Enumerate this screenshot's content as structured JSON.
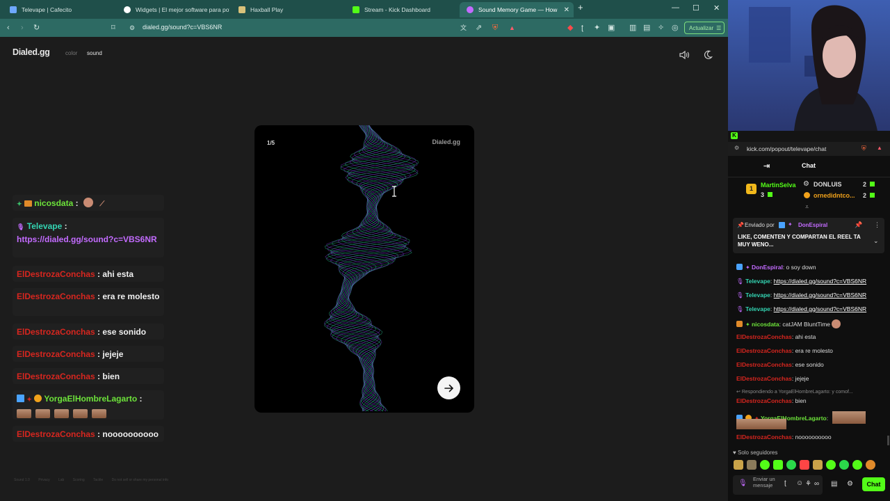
{
  "browser": {
    "tabs": [
      {
        "label": "Televape | Cafecito",
        "color": "#6ea8ff"
      },
      {
        "label": "Widgets | El mejor software para pot",
        "color": "#ffffff"
      },
      {
        "label": "Haxball Play",
        "color": "#d9c27a"
      },
      {
        "label": "Stream - Kick Dashboard",
        "color": "#53fc18"
      },
      {
        "label": "Sound Memory Game — How",
        "color": "#c36bff"
      }
    ],
    "url": "dialed.gg/sound?c=VBS6NR",
    "update_label": "Actualizar"
  },
  "site": {
    "logo": "Dialed.gg",
    "nav_color": "color",
    "nav_sound": "sound",
    "card_counter": "1/5",
    "card_brand": "Dialed.gg",
    "footer": [
      "Sound 1.0",
      "Privacy",
      "Lab",
      "Scoring",
      "Tactile",
      "Do not sell or share my personal info"
    ]
  },
  "overlay_chat": [
    {
      "user": "nicosdata",
      "text": "",
      "color": "green"
    },
    {
      "user": "Televape",
      "text": "https://dialed.gg/sound?c=VBS6NR",
      "color": "teal"
    },
    {
      "user": "ElDestrozaConchas",
      "text": "ahi esta",
      "color": "red"
    },
    {
      "user": "ElDestrozaConchas",
      "text": "era re molesto",
      "color": "red"
    },
    {
      "user": "ElDestrozaConchas",
      "text": "ese sonido",
      "color": "red"
    },
    {
      "user": "ElDestrozaConchas",
      "text": "jejeje",
      "color": "red"
    },
    {
      "user": "ElDestrozaConchas",
      "text": "bien",
      "color": "red"
    },
    {
      "user": "YorgaElHombreLagarto",
      "text": "",
      "color": "teal"
    },
    {
      "user": "ElDestrozaConchas",
      "text": "noooooooooo",
      "color": "red"
    }
  ],
  "kick": {
    "url": "kick.com/popout/televape/chat",
    "title": "Chat",
    "leaderboard": [
      {
        "name": "MartinSelva",
        "rank": "3"
      },
      {
        "name": "DONLUIS",
        "rank": "2"
      },
      {
        "name": "ornedidntco...",
        "rank": "2"
      }
    ],
    "pinned_by_label": "Enviado por",
    "pinned_by": "DonEspiral",
    "pinned_text": "LIKE, COMENTEN Y COMPARTAN EL REEL TA MUY WENO...",
    "messages": [
      {
        "user": "DonEspiral",
        "text": "o soy down",
        "color": "purple",
        "link": false
      },
      {
        "user": "Televape",
        "text": "https://dialed.gg/sound?c=VBS6NR",
        "color": "teal",
        "link": true
      },
      {
        "user": "Televape",
        "text": "https://dialed.gg/sound?c=VBS6NR",
        "color": "teal",
        "link": true
      },
      {
        "user": "Televape",
        "text": "https://dialed.gg/sound?c=VBS6NR",
        "color": "teal",
        "link": true
      },
      {
        "user": "nicosdata",
        "text": "catJAM BluntTime",
        "color": "green",
        "link": false
      },
      {
        "user": "ElDestrozaConchas",
        "text": "ahi esta",
        "color": "red",
        "link": false
      },
      {
        "user": "ElDestrozaConchas",
        "text": "era re molesto",
        "color": "red",
        "link": false
      },
      {
        "user": "ElDestrozaConchas",
        "text": "ese sonido",
        "color": "red",
        "link": false
      },
      {
        "user": "ElDestrozaConchas",
        "text": "jejeje",
        "color": "red",
        "link": false
      },
      {
        "user": "ElDestrozaConchas",
        "text": "bien",
        "color": "red",
        "link": false
      },
      {
        "user": "YorgaElHombreLagarto",
        "text": "",
        "color": "green",
        "link": false
      },
      {
        "user": "ElDestrozaConchas",
        "text": "noooooooooo",
        "color": "red",
        "link": false
      }
    ],
    "reply_note": "Respondiendo a YorgaElHombreLagarto: y comof...",
    "followers_only": "Solo seguidores",
    "input_placeholder": "Enviar un mensaje",
    "send_label": "Chat"
  }
}
